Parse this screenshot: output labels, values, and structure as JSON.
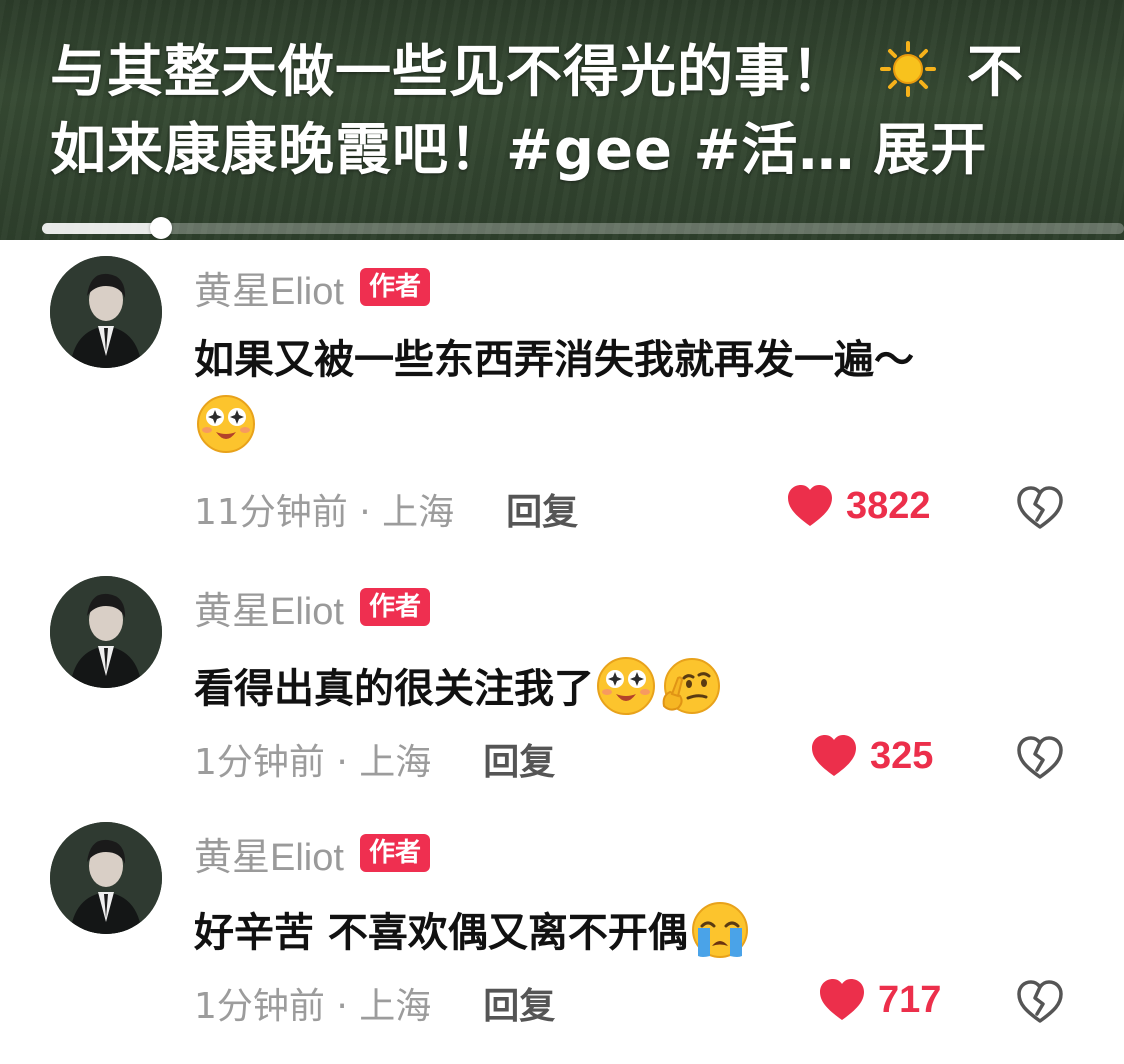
{
  "video": {
    "caption_line1": "与其整天做一些见不得光的事！",
    "caption_line1_tail": "不",
    "caption_line2": "如来康康晚霞吧！#gee #活…",
    "expand_label": "展开",
    "progress": 0.11
  },
  "comments": [
    {
      "username": "黄星Eliot",
      "badge": "作者",
      "text_line1": "如果又被一些东西弄消失我就再发一遍～",
      "emojis": [
        "starry-eyed-emoji"
      ],
      "time_location": "11分钟前 · 上海",
      "reply_label": "回复",
      "likes": "3822"
    },
    {
      "username": "黄星Eliot",
      "badge": "作者",
      "text_line1": "看得出真的很关注我了",
      "emojis": [
        "starry-eyed-emoji",
        "thinking-emoji"
      ],
      "time_location": "1分钟前 · 上海",
      "reply_label": "回复",
      "likes": "325"
    },
    {
      "username": "黄星Eliot",
      "badge": "作者",
      "text_line1": "好辛苦 不喜欢偶又离不开偶",
      "emojis": [
        "crying-emoji"
      ],
      "time_location": "1分钟前 · 上海",
      "reply_label": "回复",
      "likes": "717"
    }
  ],
  "colors": {
    "accent_red": "#ec2f4b",
    "badge_red": "#ef2f50",
    "meta_gray": "#9c9c9c"
  }
}
